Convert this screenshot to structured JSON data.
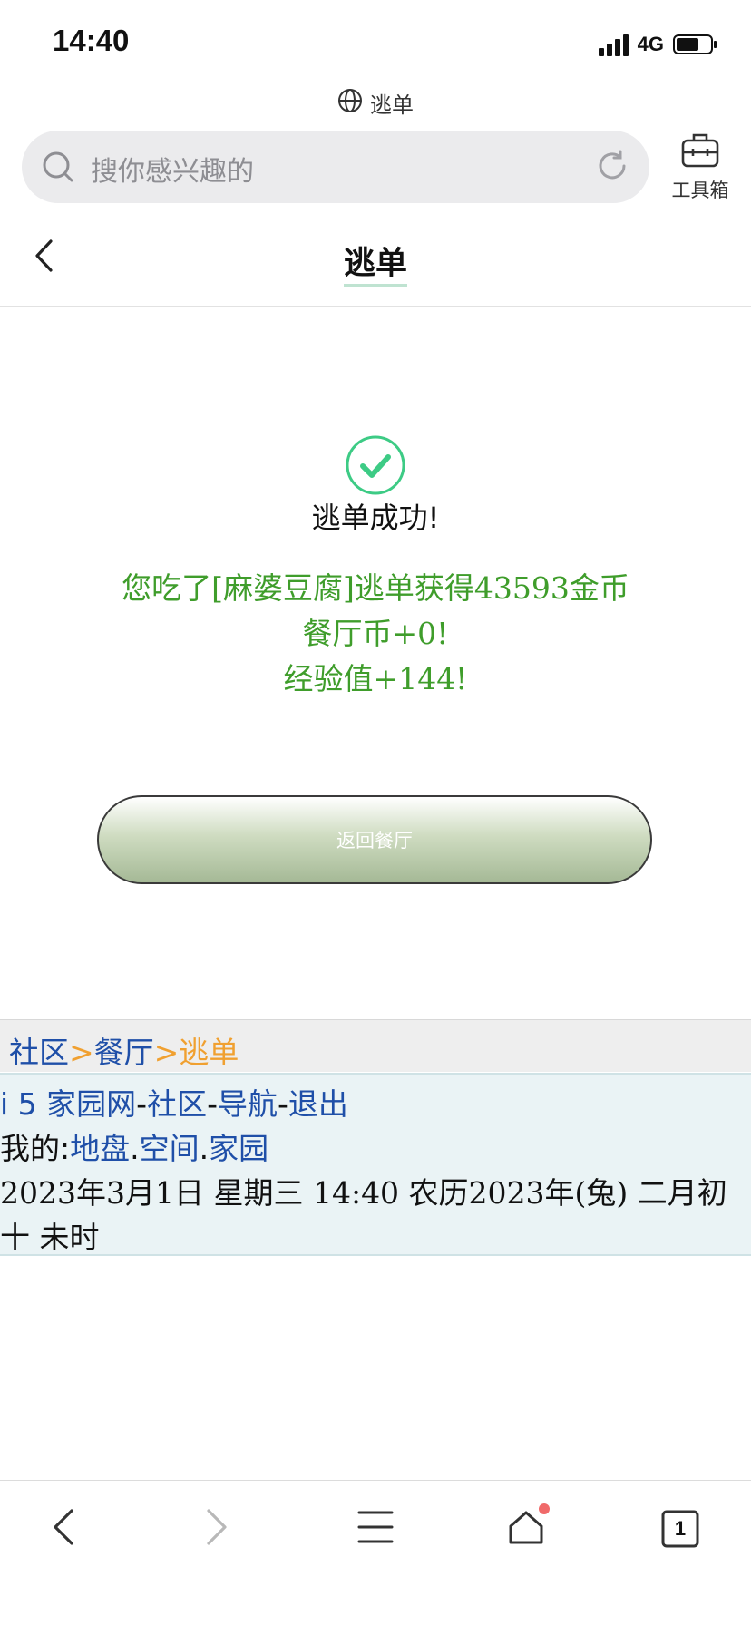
{
  "status_bar": {
    "time": "14:40",
    "network": "4G"
  },
  "site": {
    "label": "逃单"
  },
  "search": {
    "placeholder": "搜你感兴趣的"
  },
  "toolbox": {
    "label": "工具箱"
  },
  "header": {
    "title": "逃单"
  },
  "result": {
    "title": "逃单成功!",
    "line1": "您吃了[麻婆豆腐]逃单获得43593金币",
    "line2": "餐厅币+0!",
    "line3": "经验值+144!"
  },
  "return_button": {
    "label": "返回餐厅"
  },
  "breadcrumb": {
    "community": "社区",
    "sep1": ">",
    "restaurant": "餐厅",
    "sep2": ">",
    "current": "逃单"
  },
  "footer": {
    "site": "i 5 家园网",
    "dash1": "-",
    "community": "社区",
    "dash2": "-",
    "nav": "导航",
    "dash3": "-",
    "logout": "退出",
    "mine_label": "我的:",
    "territory": "地盘",
    "dot1": ".",
    "space": "空间",
    "dot2": ".",
    "home": "家园",
    "datetime_line1": "2023年3月1日  星期三  14:40  农历2023年(兔)  二月初",
    "datetime_line2": "十  未时"
  },
  "bottom_nav": {
    "tabs_count": "1"
  },
  "colors": {
    "success_green": "#3f9d2b",
    "link_blue": "#1f4fa8",
    "crumb_orange": "#f0a030",
    "check_green": "#3dcb85"
  }
}
